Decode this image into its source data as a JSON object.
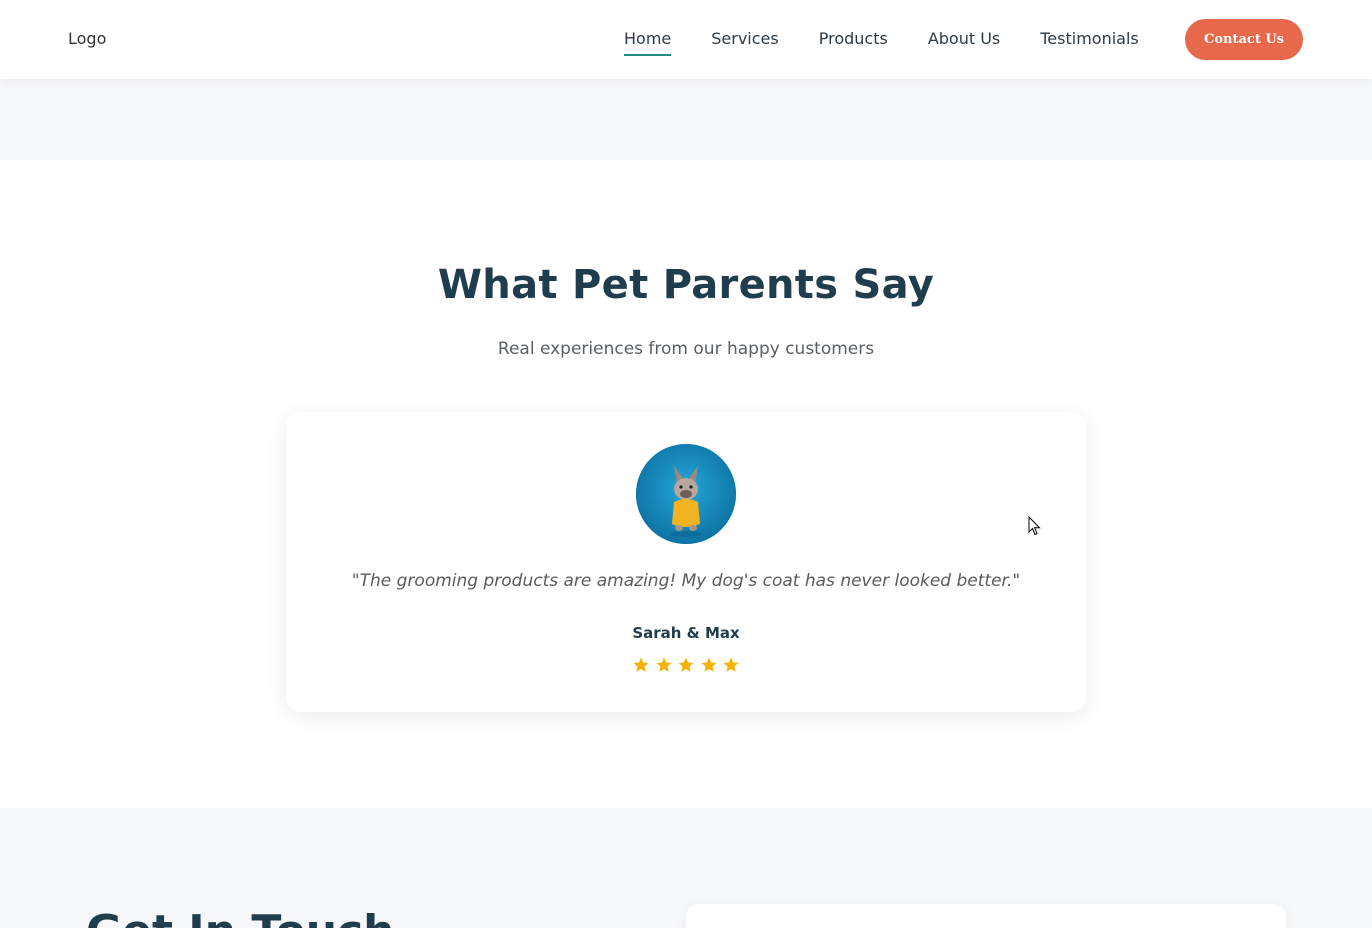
{
  "header": {
    "logo": "Logo",
    "nav": [
      {
        "label": "Home",
        "active": true
      },
      {
        "label": "Services",
        "active": false
      },
      {
        "label": "Products",
        "active": false
      },
      {
        "label": "About Us",
        "active": false
      },
      {
        "label": "Testimonials",
        "active": false
      }
    ],
    "contact_label": "Contact Us"
  },
  "testimonials": {
    "title": "What Pet Parents Say",
    "subtitle": "Real experiences from our happy customers",
    "current": {
      "quote": "\"The grooming products are amazing! My dog's coat has never looked better.\"",
      "author": "Sarah & Max",
      "rating": 5,
      "max_rating": 5
    }
  },
  "contact_section": {
    "title": "Get In Touch"
  },
  "colors": {
    "accent": "#e8684c",
    "active_underline": "#1e8c87",
    "heading": "#1f3d4c",
    "star": "#f5b301"
  }
}
